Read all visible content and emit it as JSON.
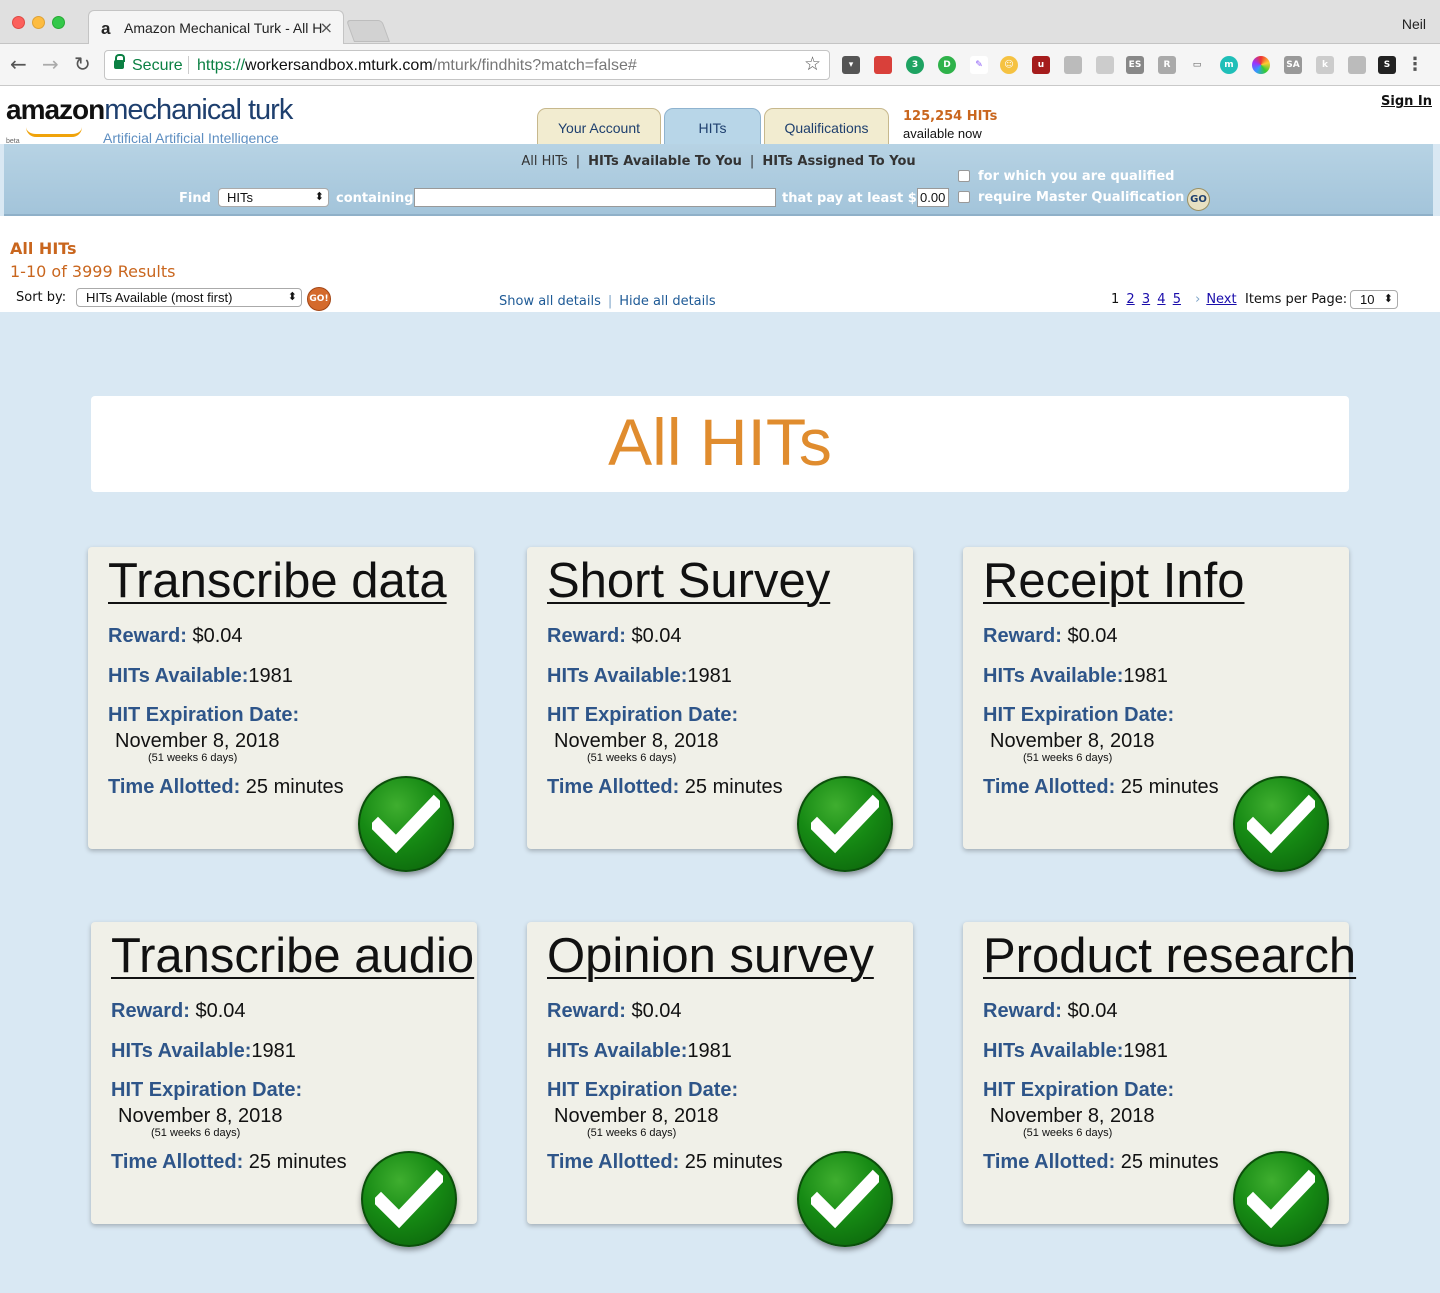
{
  "browser": {
    "tab_title": "Amazon Mechanical Turk - All HITs",
    "tab_favicon": "a",
    "profile_name": "Neil",
    "secure_label": "Secure",
    "url_scheme": "https://",
    "url_host": "workersandbox.mturk.com",
    "url_path": "/mturk/findhits?match=false#"
  },
  "header": {
    "logo_amazon": "amazon",
    "logo_mt": "mechanical turk",
    "logo_tagline": "Artificial Artificial Intelligence",
    "logo_beta": "beta",
    "tabs": [
      {
        "label": "Your Account"
      },
      {
        "label": "HITs"
      },
      {
        "label": "Qualifications"
      }
    ],
    "hits_count": "125,254 HITs",
    "hits_avail": "available now",
    "sign_in": "Sign In"
  },
  "searchbar": {
    "subnav": [
      "All HITs",
      "HITs Available To You",
      "HITs Assigned To You"
    ],
    "find_label": "Find",
    "find_select": "HITs",
    "containing_label": "containing",
    "search_value": "",
    "pay_label": "that pay at least $",
    "pay_value": "0.00",
    "qualified_label": "for which you are qualified",
    "master_label": "require Master Qualification",
    "go_label": "GO"
  },
  "results": {
    "title": "All HITs",
    "count": "1-10 of 3999 Results",
    "sort_label": "Sort by:",
    "sort_value": "HITs Available (most first)",
    "sort_go": "GO!",
    "show_details": "Show all details",
    "hide_details": "Hide all details",
    "current_page": "1",
    "pages": [
      "2",
      "3",
      "4",
      "5"
    ],
    "next": "Next",
    "ipp_label": "Items per Page:",
    "ipp_value": "10"
  },
  "main": {
    "banner_title": "All HITs",
    "labels": {
      "reward": "Reward:",
      "available": "HITs Available:",
      "expiration": "HIT Expiration Date:",
      "time": "Time Allotted:"
    },
    "cards": [
      {
        "title": "Transcribe data",
        "reward": "$0.04",
        "available": "1981",
        "expiration": "November 8, 2018",
        "expiration_note": "(51 weeks 6 days)",
        "time": "25 minutes"
      },
      {
        "title": "Short Survey",
        "reward": "$0.04",
        "available": "1981",
        "expiration": "November 8, 2018",
        "expiration_note": "(51 weeks 6 days)",
        "time": "25 minutes"
      },
      {
        "title": "Receipt Info",
        "reward": "$0.04",
        "available": "1981",
        "expiration": "November 8, 2018",
        "expiration_note": "(51 weeks 6 days)",
        "time": "25 minutes"
      },
      {
        "title": "Transcribe audio",
        "reward": "$0.04",
        "available": "1981",
        "expiration": "November 8, 2018",
        "expiration_note": "(51 weeks 6 days)",
        "time": "25 minutes"
      },
      {
        "title": "Opinion survey",
        "reward": "$0.04",
        "available": "1981",
        "expiration": "November 8, 2018",
        "expiration_note": "(51 weeks 6 days)",
        "time": "25 minutes"
      },
      {
        "title": "Product research",
        "reward": "$0.04",
        "available": "1981",
        "expiration": "November 8, 2018",
        "expiration_note": "(51 weeks 6 days)",
        "time": "25 minutes"
      }
    ]
  },
  "icons": {
    "accept": "checkmark-icon",
    "lock": "lock-icon",
    "star": "bookmark-star-icon"
  },
  "colors": {
    "accent_orange": "#c9661e",
    "banner_orange": "#e08c2e",
    "label_blue": "#2e5589",
    "page_bg": "#d9e8f3",
    "card_bg": "#f0f0e8",
    "check_green": "#168a14"
  }
}
